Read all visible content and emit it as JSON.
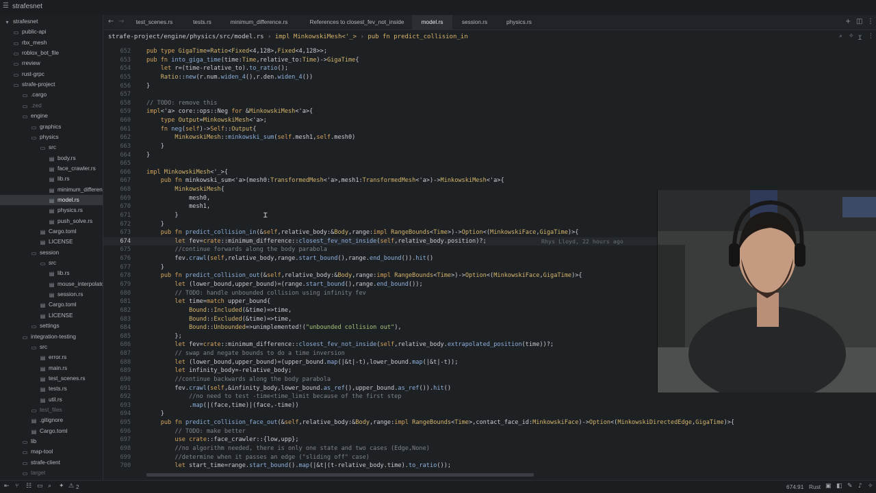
{
  "window": {
    "project_name": "strafesnet"
  },
  "sidebar": {
    "items": [
      {
        "label": "strafesnet",
        "kind": "root"
      },
      {
        "label": "public-api",
        "kind": "folder"
      },
      {
        "label": "rbx_mesh",
        "kind": "folder"
      },
      {
        "label": "roblox_bot_file",
        "kind": "folder"
      },
      {
        "label": "rreview",
        "kind": "folder"
      },
      {
        "label": "rust-grpc",
        "kind": "folder"
      },
      {
        "label": "strafe-project",
        "kind": "folder-open"
      },
      {
        "label": ".cargo",
        "kind": "folder"
      },
      {
        "label": ".zed",
        "kind": "folder"
      },
      {
        "label": "engine",
        "kind": "folder-open"
      },
      {
        "label": "graphics",
        "kind": "folder"
      },
      {
        "label": "physics",
        "kind": "folder-open"
      },
      {
        "label": "src",
        "kind": "folder-open"
      },
      {
        "label": "body.rs",
        "kind": "file"
      },
      {
        "label": "face_crawler.rs",
        "kind": "file"
      },
      {
        "label": "lib.rs",
        "kind": "file"
      },
      {
        "label": "minimum_difference.rs",
        "kind": "file"
      },
      {
        "label": "model.rs",
        "kind": "file"
      },
      {
        "label": "physics.rs",
        "kind": "file"
      },
      {
        "label": "push_solve.rs",
        "kind": "file"
      },
      {
        "label": "Cargo.toml",
        "kind": "file"
      },
      {
        "label": "LICENSE",
        "kind": "file"
      },
      {
        "label": "session",
        "kind": "folder-open"
      },
      {
        "label": "src",
        "kind": "folder-open"
      },
      {
        "label": "lib.rs",
        "kind": "file"
      },
      {
        "label": "mouse_interpolator.rs",
        "kind": "file"
      },
      {
        "label": "session.rs",
        "kind": "file"
      },
      {
        "label": "Cargo.toml",
        "kind": "file"
      },
      {
        "label": "LICENSE",
        "kind": "file"
      },
      {
        "label": "settings",
        "kind": "folder"
      },
      {
        "label": "integration-testing",
        "kind": "folder-open"
      },
      {
        "label": "src",
        "kind": "folder-open"
      },
      {
        "label": "error.rs",
        "kind": "file"
      },
      {
        "label": "main.rs",
        "kind": "file"
      },
      {
        "label": "test_scenes.rs",
        "kind": "file"
      },
      {
        "label": "tests.rs",
        "kind": "file"
      },
      {
        "label": "util.rs",
        "kind": "file"
      },
      {
        "label": "test_files",
        "kind": "folder"
      },
      {
        "label": ".gitignore",
        "kind": "file"
      },
      {
        "label": "Cargo.toml",
        "kind": "file"
      },
      {
        "label": "lib",
        "kind": "folder"
      },
      {
        "label": "map-tool",
        "kind": "folder"
      },
      {
        "label": "strafe-client",
        "kind": "folder"
      },
      {
        "label": "target",
        "kind": "folder"
      }
    ]
  },
  "tabs": [
    {
      "label": "test_scenes.rs"
    },
    {
      "label": "tests.rs"
    },
    {
      "label": "minimum_difference.rs"
    },
    {
      "label": "References to closest_fev_not_inside"
    },
    {
      "label": "model.rs",
      "active": true
    },
    {
      "label": "session.rs"
    },
    {
      "label": "physics.rs"
    }
  ],
  "breadcrumb": {
    "path": "strafe-project/engine/physics/src/model.rs",
    "separator": "›",
    "impl": "impl MinkowskiMesh<'_>",
    "fn": "pub fn predict_collision_in"
  },
  "editor": {
    "first_line": 652,
    "current_line": 674,
    "blame": "Rhys Lloyd, 22 hours ago",
    "lines": [
      "pub type GigaTime=Ratio<Fixed<4,128>,Fixed<4,128>>;",
      "pub fn into_giga_time(time:Time,relative_to:Time)->GigaTime{",
      "    let r=(time-relative_to).to_ratio();",
      "    Ratio::new(r.num.widen_4(),r.den.widen_4())",
      "}",
      "",
      "// TODO: remove this",
      "impl<'a> core::ops::Neg for &MinkowskiMesh<'a>{",
      "    type Output=MinkowskiMesh<'a>;",
      "    fn neg(self)->Self::Output{",
      "        MinkowskiMesh::minkowski_sum(self.mesh1,self.mesh0)",
      "    }",
      "}",
      "",
      "impl MinkowskiMesh<'_>{",
      "    pub fn minkowski_sum<'a>(mesh0:TransformedMesh<'a>,mesh1:TransformedMesh<'a>)->MinkowskiMesh<'a>{",
      "        MinkowskiMesh{",
      "            mesh0,",
      "            mesh1,",
      "        }",
      "    }",
      "    pub fn predict_collision_in(&self,relative_body:&Body,range:impl RangeBounds<Time>)->Option<(MinkowskiFace,GigaTime)>{",
      "        let fev=crate::minimum_difference::closest_fev_not_inside(self,relative_body.position)?;",
      "        //continue forwards along the body parabola",
      "        fev.crawl(self,relative_body,range.start_bound(),range.end_bound()).hit()",
      "    }",
      "    pub fn predict_collision_out(&self,relative_body:&Body,range:impl RangeBounds<Time>)->Option<(MinkowskiFace,GigaTime)>{",
      "        let (lower_bound,upper_bound)=(range.start_bound(),range.end_bound());",
      "        // TODO: handle unbounded collision using infinity fev",
      "        let time=match upper_bound{",
      "            Bound::Included(&time)=>time,",
      "            Bound::Excluded(&time)=>time,",
      "            Bound::Unbounded=>unimplemented!(\"unbounded collision out\"),",
      "        };",
      "        let fev=crate::minimum_difference::closest_fev_not_inside(self,relative_body.extrapolated_position(time))?;",
      "        // swap and negate bounds to do a time inversion",
      "        let (lower_bound,upper_bound)=(upper_bound.map(|&t|-t),lower_bound.map(|&t|-t));",
      "        let infinity_body=-relative_body;",
      "        //continue backwards along the body parabola",
      "        fev.crawl(self,&infinity_body,lower_bound.as_ref(),upper_bound.as_ref()).hit()",
      "            //no need to test -time<time_limit because of the first step",
      "            .map(|(face,time)|(face,-time))",
      "    }",
      "    pub fn predict_collision_face_out(&self,relative_body:&Body,range:impl RangeBounds<Time>,contact_face_id:MinkowskiFace)->Option<(MinkowskiDirectedEdge,GigaTime)>{",
      "        // TODO: make better",
      "        use crate::face_crawler::{low,upp};",
      "        //no algorithm needed, there is only one state and two cases (Edge,None)",
      "        //determine when it passes an edge (\"sliding off\" case)",
      "        let start_time=range.start_bound().map(|&t|(t-relative_body.time).to_ratio());"
    ]
  },
  "statusbar": {
    "diagnostics_count": "2",
    "cursor_position": "674:91",
    "language": "Rust"
  },
  "colors": {
    "keyword": "#d6a45d",
    "function": "#8fb1dd",
    "comment": "#7f848b",
    "string": "#a9c47a",
    "background": "#1e2124"
  },
  "icons": [
    "menu-icon",
    "chevron-back-icon",
    "chevron-forward-icon",
    "plus-icon",
    "split-icon",
    "more-icon",
    "search-icon",
    "magic-icon",
    "cursor-icon",
    "terminal-icon",
    "warning-icon"
  ]
}
